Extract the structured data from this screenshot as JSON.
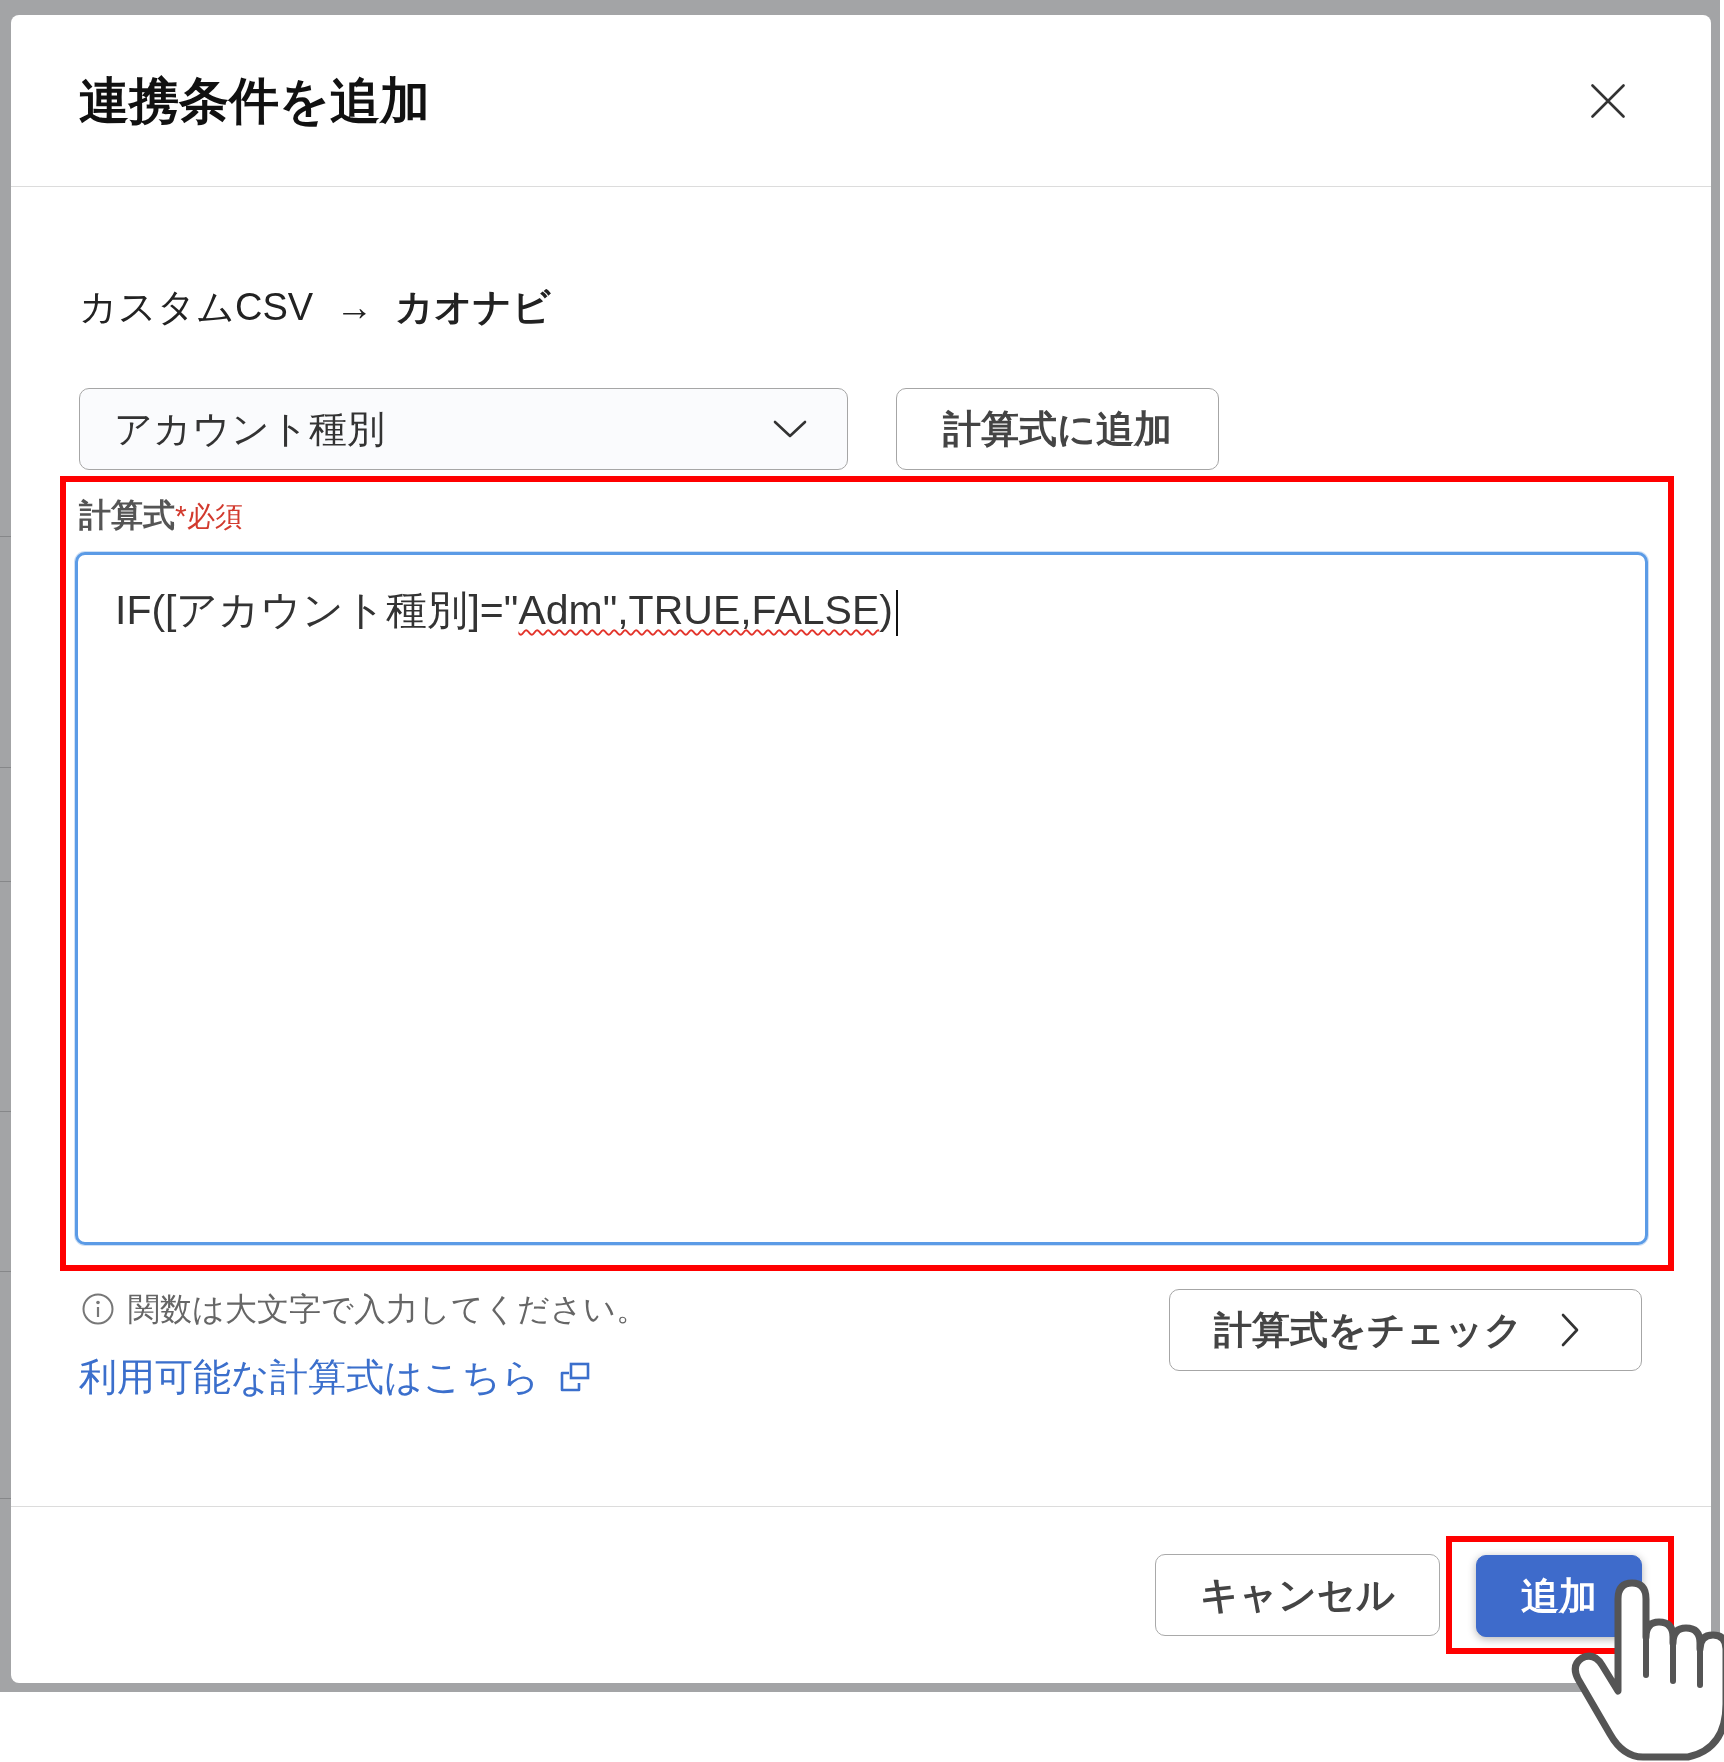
{
  "dialog": {
    "title": "連携条件を追加"
  },
  "mapping": {
    "source": "カスタムCSV",
    "arrow": "→",
    "target": "カオナビ"
  },
  "field_select": {
    "value": "アカウント種別"
  },
  "add_button": {
    "label": "計算式に追加"
  },
  "formula": {
    "label": "計算式",
    "required_mark": "*",
    "required_text": "必須",
    "highlighted": true,
    "focused": true,
    "value": [
      {
        "text": "IF([アカウント種別]=\"",
        "misspelled": false
      },
      {
        "text": "Adm\",TRUE,FALSE",
        "misspelled": true
      },
      {
        "text": ")",
        "misspelled": false
      }
    ]
  },
  "hint": {
    "text": "関数は大文字で入力してください。"
  },
  "help_link": {
    "label": "利用可能な計算式はこちら"
  },
  "check_button": {
    "label": "計算式をチェック"
  },
  "footer": {
    "buttons": [
      {
        "label": "キャンセル",
        "kind": "secondary",
        "highlighted": false
      },
      {
        "label": "追加",
        "kind": "primary",
        "highlighted": true
      }
    ]
  }
}
